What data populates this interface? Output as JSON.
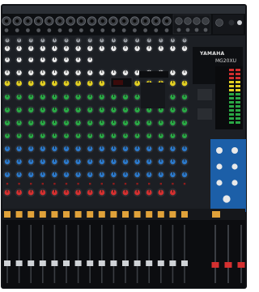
{
  "product": {
    "brand_text": "YAMAHA",
    "model_text": "MG20XU"
  },
  "colors": {
    "chassis": "#121418",
    "panel": "#1c1f24",
    "knob_body": "#2a2d32",
    "cap_white": "#e9e9e9",
    "cap_yellow": "#e2cf22",
    "cap_green": "#2aa845",
    "cap_blue": "#2c78c8",
    "cap_red": "#d43030",
    "cap_grey": "#9a9ea4",
    "master_panel": "#1c5fa8",
    "button_orange": "#e0a23a",
    "fader_cap": "#cfd2d6"
  },
  "mono_channel_count": 12,
  "stereo_channel_count": 4,
  "icons": [
    "yamaha-logo-icon",
    "xlr-input-icon",
    "trs-jack-icon",
    "rotary-knob-icon",
    "channel-fader-icon",
    "level-meter-icon",
    "on-button-icon"
  ]
}
